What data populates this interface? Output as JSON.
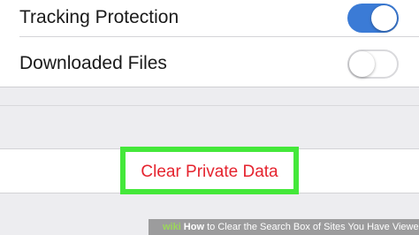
{
  "settings": {
    "rows": [
      {
        "label": "Tracking Protection",
        "toggle_state": "on"
      },
      {
        "label": "Downloaded Files",
        "toggle_state": "off"
      }
    ],
    "toggle_on_color": "#3b7bd6"
  },
  "actions": {
    "clear_private_data_label": "Clear Private Data",
    "label_color": "#e5232e",
    "highlight_color": "#44e83a"
  },
  "watermark": {
    "brand": "wiki",
    "how": "How",
    "text": "to Clear the Search Box of Sites You Have Viewed Online"
  }
}
